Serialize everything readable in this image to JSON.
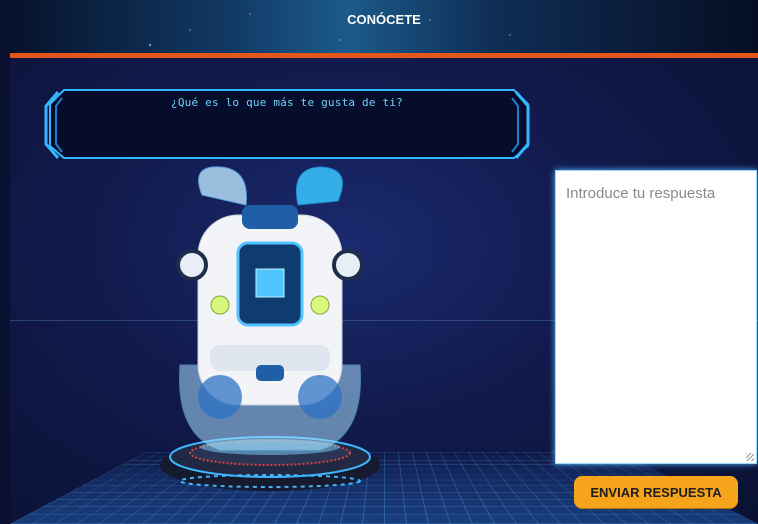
{
  "header": {
    "title": "CONÓCETE"
  },
  "question": {
    "text": "¿Qué es lo que más te gusta de ti?"
  },
  "answer": {
    "placeholder": "Introduce tu respuesta",
    "value": ""
  },
  "actions": {
    "send_label": "ENVIAR RESPUESTA"
  },
  "colors": {
    "accent_orange": "#e4551b",
    "button": "#f6a41c",
    "neon_blue": "#35b6ff",
    "background": "#111a4c"
  },
  "icons": {
    "robot": "robot-hologram-illustration"
  }
}
